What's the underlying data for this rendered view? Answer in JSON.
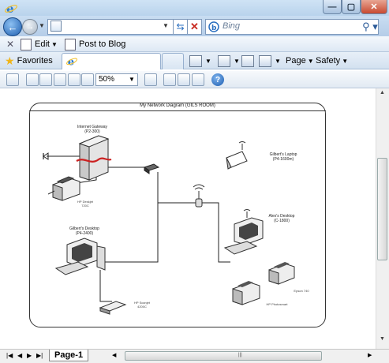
{
  "browser": {
    "search_placeholder": "Bing",
    "window_buttons": {
      "minimize": "—",
      "maximize": "▢",
      "close": "✕"
    }
  },
  "command_bar": {
    "edit_label": "Edit",
    "post_blog_label": "Post to Blog"
  },
  "favorites_bar": {
    "favorites_label": "Favorites",
    "page_label": "Page",
    "safety_label": "Safety"
  },
  "visio_toolbar": {
    "zoom_value": "50%"
  },
  "diagram": {
    "title": "My Network Diagram (GILS ROOM)",
    "nodes": {
      "gateway": {
        "name": "Internet Gateway",
        "model": "(P2-300)"
      },
      "printer_top": {
        "name": "HP Deskjet",
        "model": "720C"
      },
      "desktop_gilbert": {
        "name": "Gilbert's Desktop",
        "model": "(P4-2400)"
      },
      "scanner": {
        "name": "HP Scanjet",
        "model": "4200C"
      },
      "laptop": {
        "name": "Gilbert's Laptop",
        "model": "(P4-1600m)"
      },
      "desktop_alex": {
        "name": "Alex's Desktop",
        "model": "(C-1800)"
      },
      "printer_epson": {
        "name": "Epson 740"
      },
      "printer_hp": {
        "name": "HP Photosmart"
      }
    }
  },
  "bottom": {
    "page_tab": "Page-1"
  },
  "icons": [
    "ie-logo",
    "back-arrow-icon",
    "forward-arrow-icon",
    "page-icon",
    "refresh-icon",
    "stop-icon",
    "bing-icon",
    "search-icon",
    "favorites-star-icon",
    "home-icon",
    "feeds-icon",
    "mail-icon",
    "print-icon",
    "help-icon"
  ],
  "colors": {
    "accent": "#1f5fb0",
    "close": "#c84a31",
    "cable_red": "#cc2222"
  }
}
